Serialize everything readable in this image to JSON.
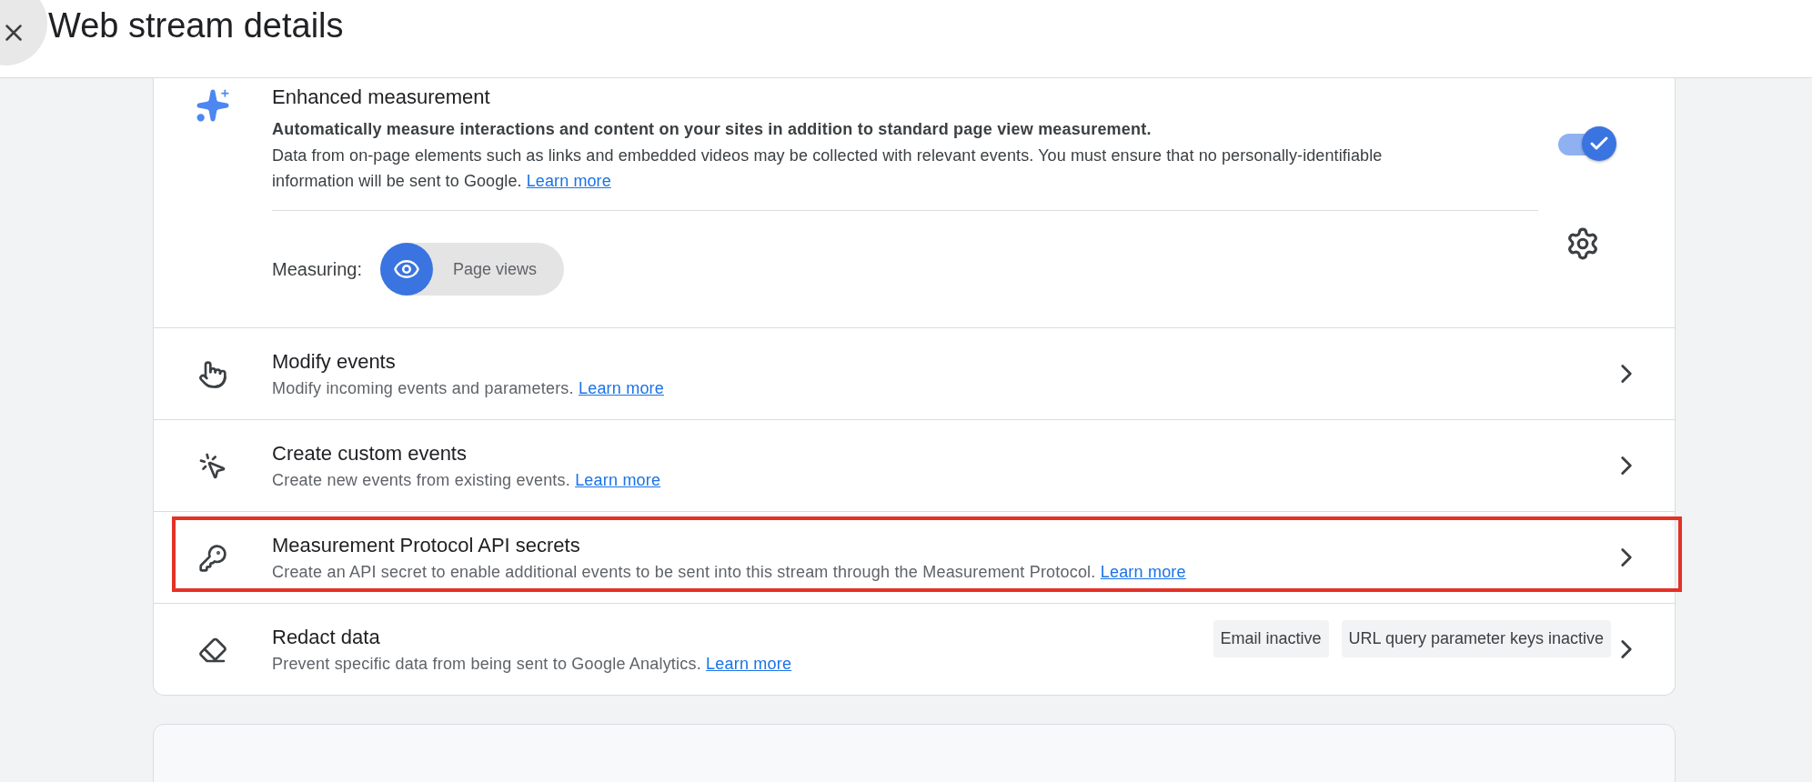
{
  "header": {
    "title": "Web stream details"
  },
  "enhanced": {
    "title": "Enhanced measurement",
    "lead": "Automatically measure interactions and content on your sites in addition to standard page view measurement.",
    "body": "Data from on-page elements such as links and embedded videos may be collected with relevant events. You must ensure that no personally-identifiable information will be sent to Google. ",
    "link": "Learn more",
    "on": true,
    "measuring_label": "Measuring:",
    "measures": [
      {
        "label": "Page views",
        "on": true
      }
    ]
  },
  "rows": [
    {
      "title": "Modify events",
      "description": "Modify incoming events and parameters. ",
      "link": "Learn more",
      "highlighted": false
    },
    {
      "title": "Create custom events",
      "description": "Create new events from existing events. ",
      "link": "Learn more",
      "highlighted": false
    },
    {
      "title": "Measurement Protocol API secrets",
      "description": "Create an API secret to enable additional events to be sent into this stream through the Measurement Protocol. ",
      "link": "Learn more",
      "highlighted": true
    },
    {
      "title": "Redact data",
      "description": "Prevent specific data from being sent to Google Analytics. ",
      "link": "Learn more",
      "highlighted": false,
      "tags": [
        "Email inactive",
        "URL query parameter keys inactive"
      ]
    }
  ]
}
